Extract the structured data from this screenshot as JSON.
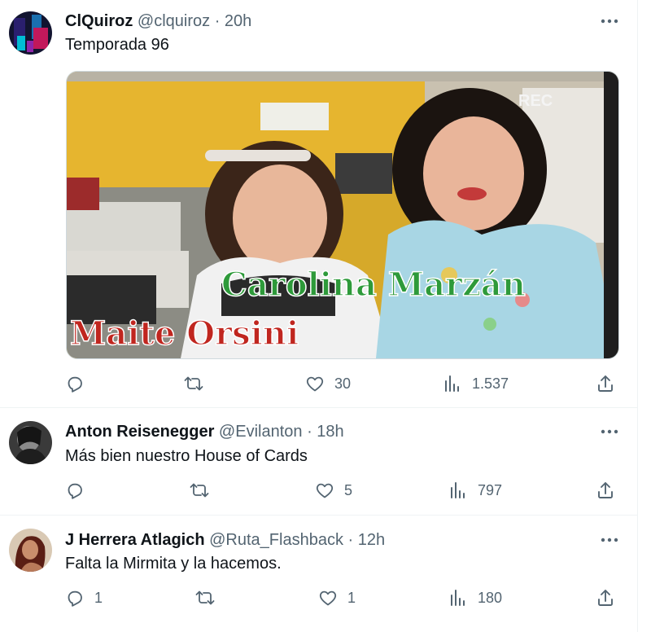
{
  "tweets": [
    {
      "name": "ClQuiroz",
      "handle": "@clquiroz",
      "dot": "·",
      "time": "20h",
      "text": "Temporada 96",
      "media": {
        "caption_top": "Carolina Marzán",
        "caption_bottom": "Maite Orsini",
        "rec": "REC"
      },
      "actions": {
        "replies": "",
        "retweets": "",
        "likes": "30",
        "views": "1.537"
      }
    },
    {
      "name": "Anton Reisenegger",
      "handle": "@Evilanton",
      "dot": "·",
      "time": "18h",
      "text": "Más bien nuestro House of Cards",
      "actions": {
        "replies": "",
        "retweets": "",
        "likes": "5",
        "views": "797"
      }
    },
    {
      "name": "J Herrera Atlagich",
      "handle": "@Ruta_Flashback",
      "dot": "·",
      "time": "12h",
      "text": "Falta la Mirmita y la hacemos.",
      "actions": {
        "replies": "1",
        "retweets": "",
        "likes": "1",
        "views": "180"
      }
    }
  ],
  "icons": {
    "reply": "reply-icon",
    "retweet": "retweet-icon",
    "like": "heart-icon",
    "views": "views-icon",
    "share": "share-icon",
    "more": "more-icon"
  },
  "colors": {
    "text": "#0f1419",
    "secondary": "#536471",
    "border": "#eff3f4"
  }
}
